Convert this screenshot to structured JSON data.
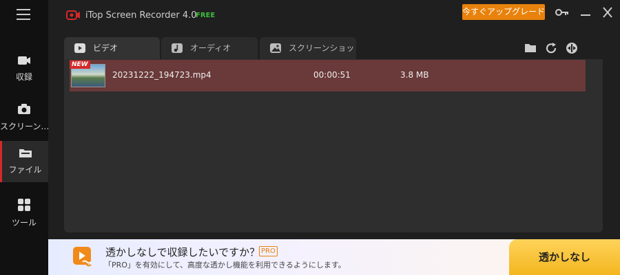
{
  "app": {
    "title": "iTop Screen Recorder 4.0",
    "badge": "FREE",
    "upgrade_label": "今すぐアップグレード"
  },
  "sidebar": {
    "items": [
      {
        "label": "収録",
        "icon": "video-camera-icon"
      },
      {
        "label": "スクリーン…",
        "icon": "camera-icon"
      },
      {
        "label": "ファイル",
        "icon": "folder-icon",
        "active": true
      },
      {
        "label": "ツール",
        "icon": "grid-icon"
      }
    ]
  },
  "tabs": [
    {
      "label": "ビデオ",
      "icon": "video-icon",
      "active": true
    },
    {
      "label": "オーディオ",
      "icon": "music-note-icon"
    },
    {
      "label": "スクリーンショット",
      "icon": "image-icon"
    }
  ],
  "files": [
    {
      "badge": "NEW",
      "name": "20231222_194723.mp4",
      "duration": "00:00:51",
      "size": "3.8 MB"
    }
  ],
  "banner": {
    "title": "透かしなしで収録したいですか？",
    "pro_badge": "PRO",
    "subtitle": "「PRO」を有効にして、高度な透かし機能を利用できるようにします。",
    "cta_label": "透かしなし"
  },
  "colors": {
    "accent": "#d42a2a",
    "upgrade": "#e8820c",
    "row_selected": "#6a3939",
    "cta": "#f3b61f"
  }
}
